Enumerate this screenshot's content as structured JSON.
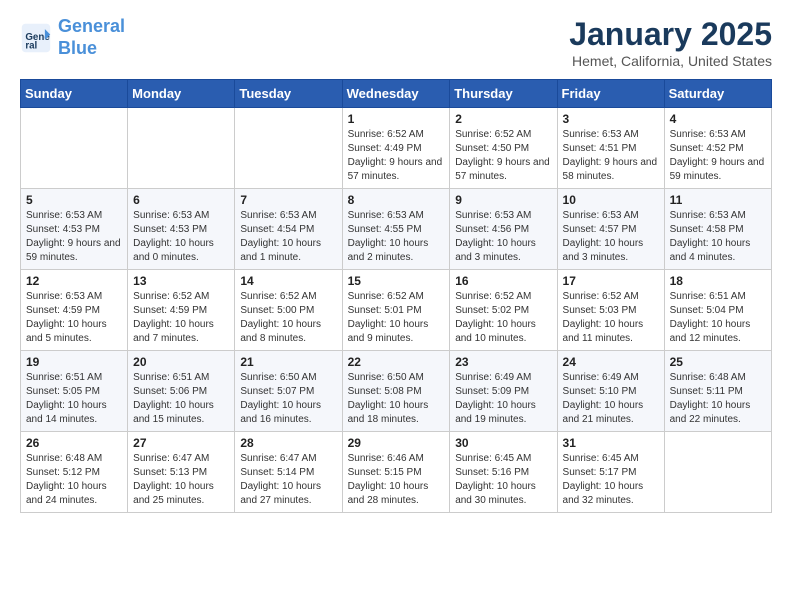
{
  "header": {
    "logo_line1": "General",
    "logo_line2": "Blue",
    "title": "January 2025",
    "subtitle": "Hemet, California, United States"
  },
  "days_of_week": [
    "Sunday",
    "Monday",
    "Tuesday",
    "Wednesday",
    "Thursday",
    "Friday",
    "Saturday"
  ],
  "weeks": [
    [
      {
        "day": "",
        "info": ""
      },
      {
        "day": "",
        "info": ""
      },
      {
        "day": "",
        "info": ""
      },
      {
        "day": "1",
        "info": "Sunrise: 6:52 AM\nSunset: 4:49 PM\nDaylight: 9 hours and 57 minutes."
      },
      {
        "day": "2",
        "info": "Sunrise: 6:52 AM\nSunset: 4:50 PM\nDaylight: 9 hours and 57 minutes."
      },
      {
        "day": "3",
        "info": "Sunrise: 6:53 AM\nSunset: 4:51 PM\nDaylight: 9 hours and 58 minutes."
      },
      {
        "day": "4",
        "info": "Sunrise: 6:53 AM\nSunset: 4:52 PM\nDaylight: 9 hours and 59 minutes."
      }
    ],
    [
      {
        "day": "5",
        "info": "Sunrise: 6:53 AM\nSunset: 4:53 PM\nDaylight: 9 hours and 59 minutes."
      },
      {
        "day": "6",
        "info": "Sunrise: 6:53 AM\nSunset: 4:53 PM\nDaylight: 10 hours and 0 minutes."
      },
      {
        "day": "7",
        "info": "Sunrise: 6:53 AM\nSunset: 4:54 PM\nDaylight: 10 hours and 1 minute."
      },
      {
        "day": "8",
        "info": "Sunrise: 6:53 AM\nSunset: 4:55 PM\nDaylight: 10 hours and 2 minutes."
      },
      {
        "day": "9",
        "info": "Sunrise: 6:53 AM\nSunset: 4:56 PM\nDaylight: 10 hours and 3 minutes."
      },
      {
        "day": "10",
        "info": "Sunrise: 6:53 AM\nSunset: 4:57 PM\nDaylight: 10 hours and 3 minutes."
      },
      {
        "day": "11",
        "info": "Sunrise: 6:53 AM\nSunset: 4:58 PM\nDaylight: 10 hours and 4 minutes."
      }
    ],
    [
      {
        "day": "12",
        "info": "Sunrise: 6:53 AM\nSunset: 4:59 PM\nDaylight: 10 hours and 5 minutes."
      },
      {
        "day": "13",
        "info": "Sunrise: 6:52 AM\nSunset: 4:59 PM\nDaylight: 10 hours and 7 minutes."
      },
      {
        "day": "14",
        "info": "Sunrise: 6:52 AM\nSunset: 5:00 PM\nDaylight: 10 hours and 8 minutes."
      },
      {
        "day": "15",
        "info": "Sunrise: 6:52 AM\nSunset: 5:01 PM\nDaylight: 10 hours and 9 minutes."
      },
      {
        "day": "16",
        "info": "Sunrise: 6:52 AM\nSunset: 5:02 PM\nDaylight: 10 hours and 10 minutes."
      },
      {
        "day": "17",
        "info": "Sunrise: 6:52 AM\nSunset: 5:03 PM\nDaylight: 10 hours and 11 minutes."
      },
      {
        "day": "18",
        "info": "Sunrise: 6:51 AM\nSunset: 5:04 PM\nDaylight: 10 hours and 12 minutes."
      }
    ],
    [
      {
        "day": "19",
        "info": "Sunrise: 6:51 AM\nSunset: 5:05 PM\nDaylight: 10 hours and 14 minutes."
      },
      {
        "day": "20",
        "info": "Sunrise: 6:51 AM\nSunset: 5:06 PM\nDaylight: 10 hours and 15 minutes."
      },
      {
        "day": "21",
        "info": "Sunrise: 6:50 AM\nSunset: 5:07 PM\nDaylight: 10 hours and 16 minutes."
      },
      {
        "day": "22",
        "info": "Sunrise: 6:50 AM\nSunset: 5:08 PM\nDaylight: 10 hours and 18 minutes."
      },
      {
        "day": "23",
        "info": "Sunrise: 6:49 AM\nSunset: 5:09 PM\nDaylight: 10 hours and 19 minutes."
      },
      {
        "day": "24",
        "info": "Sunrise: 6:49 AM\nSunset: 5:10 PM\nDaylight: 10 hours and 21 minutes."
      },
      {
        "day": "25",
        "info": "Sunrise: 6:48 AM\nSunset: 5:11 PM\nDaylight: 10 hours and 22 minutes."
      }
    ],
    [
      {
        "day": "26",
        "info": "Sunrise: 6:48 AM\nSunset: 5:12 PM\nDaylight: 10 hours and 24 minutes."
      },
      {
        "day": "27",
        "info": "Sunrise: 6:47 AM\nSunset: 5:13 PM\nDaylight: 10 hours and 25 minutes."
      },
      {
        "day": "28",
        "info": "Sunrise: 6:47 AM\nSunset: 5:14 PM\nDaylight: 10 hours and 27 minutes."
      },
      {
        "day": "29",
        "info": "Sunrise: 6:46 AM\nSunset: 5:15 PM\nDaylight: 10 hours and 28 minutes."
      },
      {
        "day": "30",
        "info": "Sunrise: 6:45 AM\nSunset: 5:16 PM\nDaylight: 10 hours and 30 minutes."
      },
      {
        "day": "31",
        "info": "Sunrise: 6:45 AM\nSunset: 5:17 PM\nDaylight: 10 hours and 32 minutes."
      },
      {
        "day": "",
        "info": ""
      }
    ]
  ]
}
